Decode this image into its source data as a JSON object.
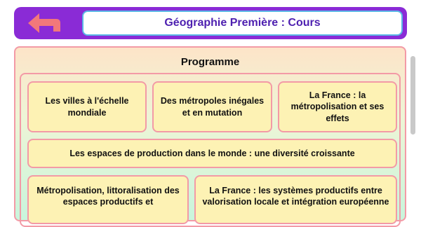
{
  "header": {
    "title": "Géographie Première : Cours",
    "back_icon": "back-arrow-icon"
  },
  "section": {
    "title": "Programme"
  },
  "cards": [
    {
      "label": "Les villes à l'échelle mondiale"
    },
    {
      "label": "Des métropoles inégales et en mutation"
    },
    {
      "label": "La France : la métropolisation et ses effets"
    },
    {
      "label": "Les espaces de production dans le monde : une diversité croissante"
    },
    {
      "label": "Métropolisation, littoralisation des espaces productifs et"
    },
    {
      "label": "La France : les systèmes productifs entre valorisation locale et intégration européenne"
    }
  ],
  "colors": {
    "header_bg": "#8a2bd6",
    "title_text": "#4d1fb0",
    "back_arrow": "#f2787a",
    "card_bg": "#fdf2b4",
    "card_border": "#f39aa6"
  }
}
